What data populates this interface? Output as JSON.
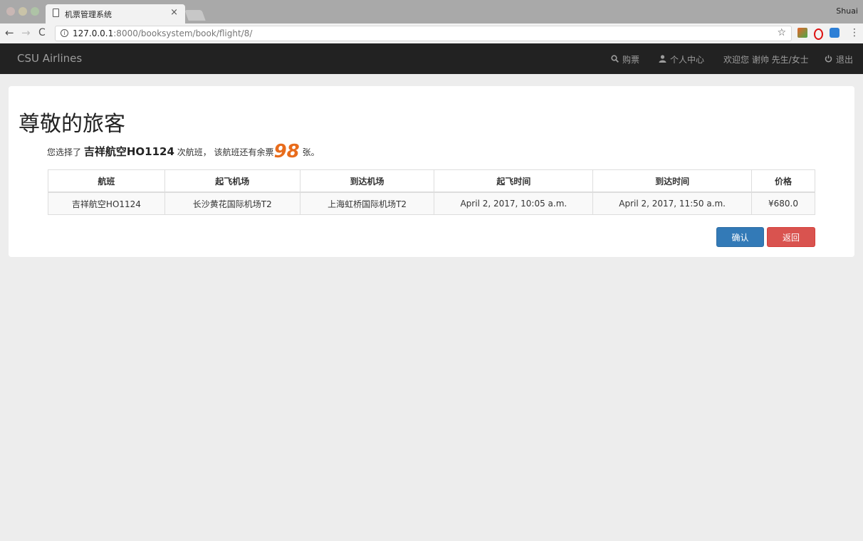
{
  "browser": {
    "tab_title": "机票管理系统",
    "tab_close": "×",
    "profile_name": "Shuai",
    "url_host": "127.0.0.1",
    "url_path": ":8000/booksystem/book/flight/8/",
    "icons": [
      "back-arrow-icon",
      "forward-arrow-icon",
      "reload-icon",
      "info-icon",
      "star-icon",
      "menu-dots-icon"
    ]
  },
  "navbar": {
    "brand": "CSU Airlines",
    "buy_label": "购票",
    "user_center_label": "个人中心",
    "welcome_label": "欢迎您 谢帅 先生/女士",
    "logout_label": "退出"
  },
  "main": {
    "heading": "尊敬的旅客",
    "info_prefix": "您选择了",
    "flight_name": "吉祥航空HO1124",
    "info_middle": "次航班， 该航班还有余票",
    "seats_left": "98",
    "info_suffix": "张。",
    "table": {
      "headers": [
        "航班",
        "起飞机场",
        "到达机场",
        "起飞时间",
        "到达时间",
        "价格"
      ],
      "rows": [
        [
          "吉祥航空HO1124",
          "长沙黄花国际机场T2",
          "上海虹桥国际机场T2",
          "April 2, 2017, 10:05 a.m.",
          "April 2, 2017, 11:50 a.m.",
          "¥680.0"
        ]
      ]
    },
    "confirm_label": "确认",
    "back_label": "返回"
  },
  "colors": {
    "navbar_bg": "#222222",
    "confirm_bg": "#337ab7",
    "back_bg": "#d9534f",
    "seat_highlight": "#e86c1c",
    "page_bg": "#ededed"
  }
}
